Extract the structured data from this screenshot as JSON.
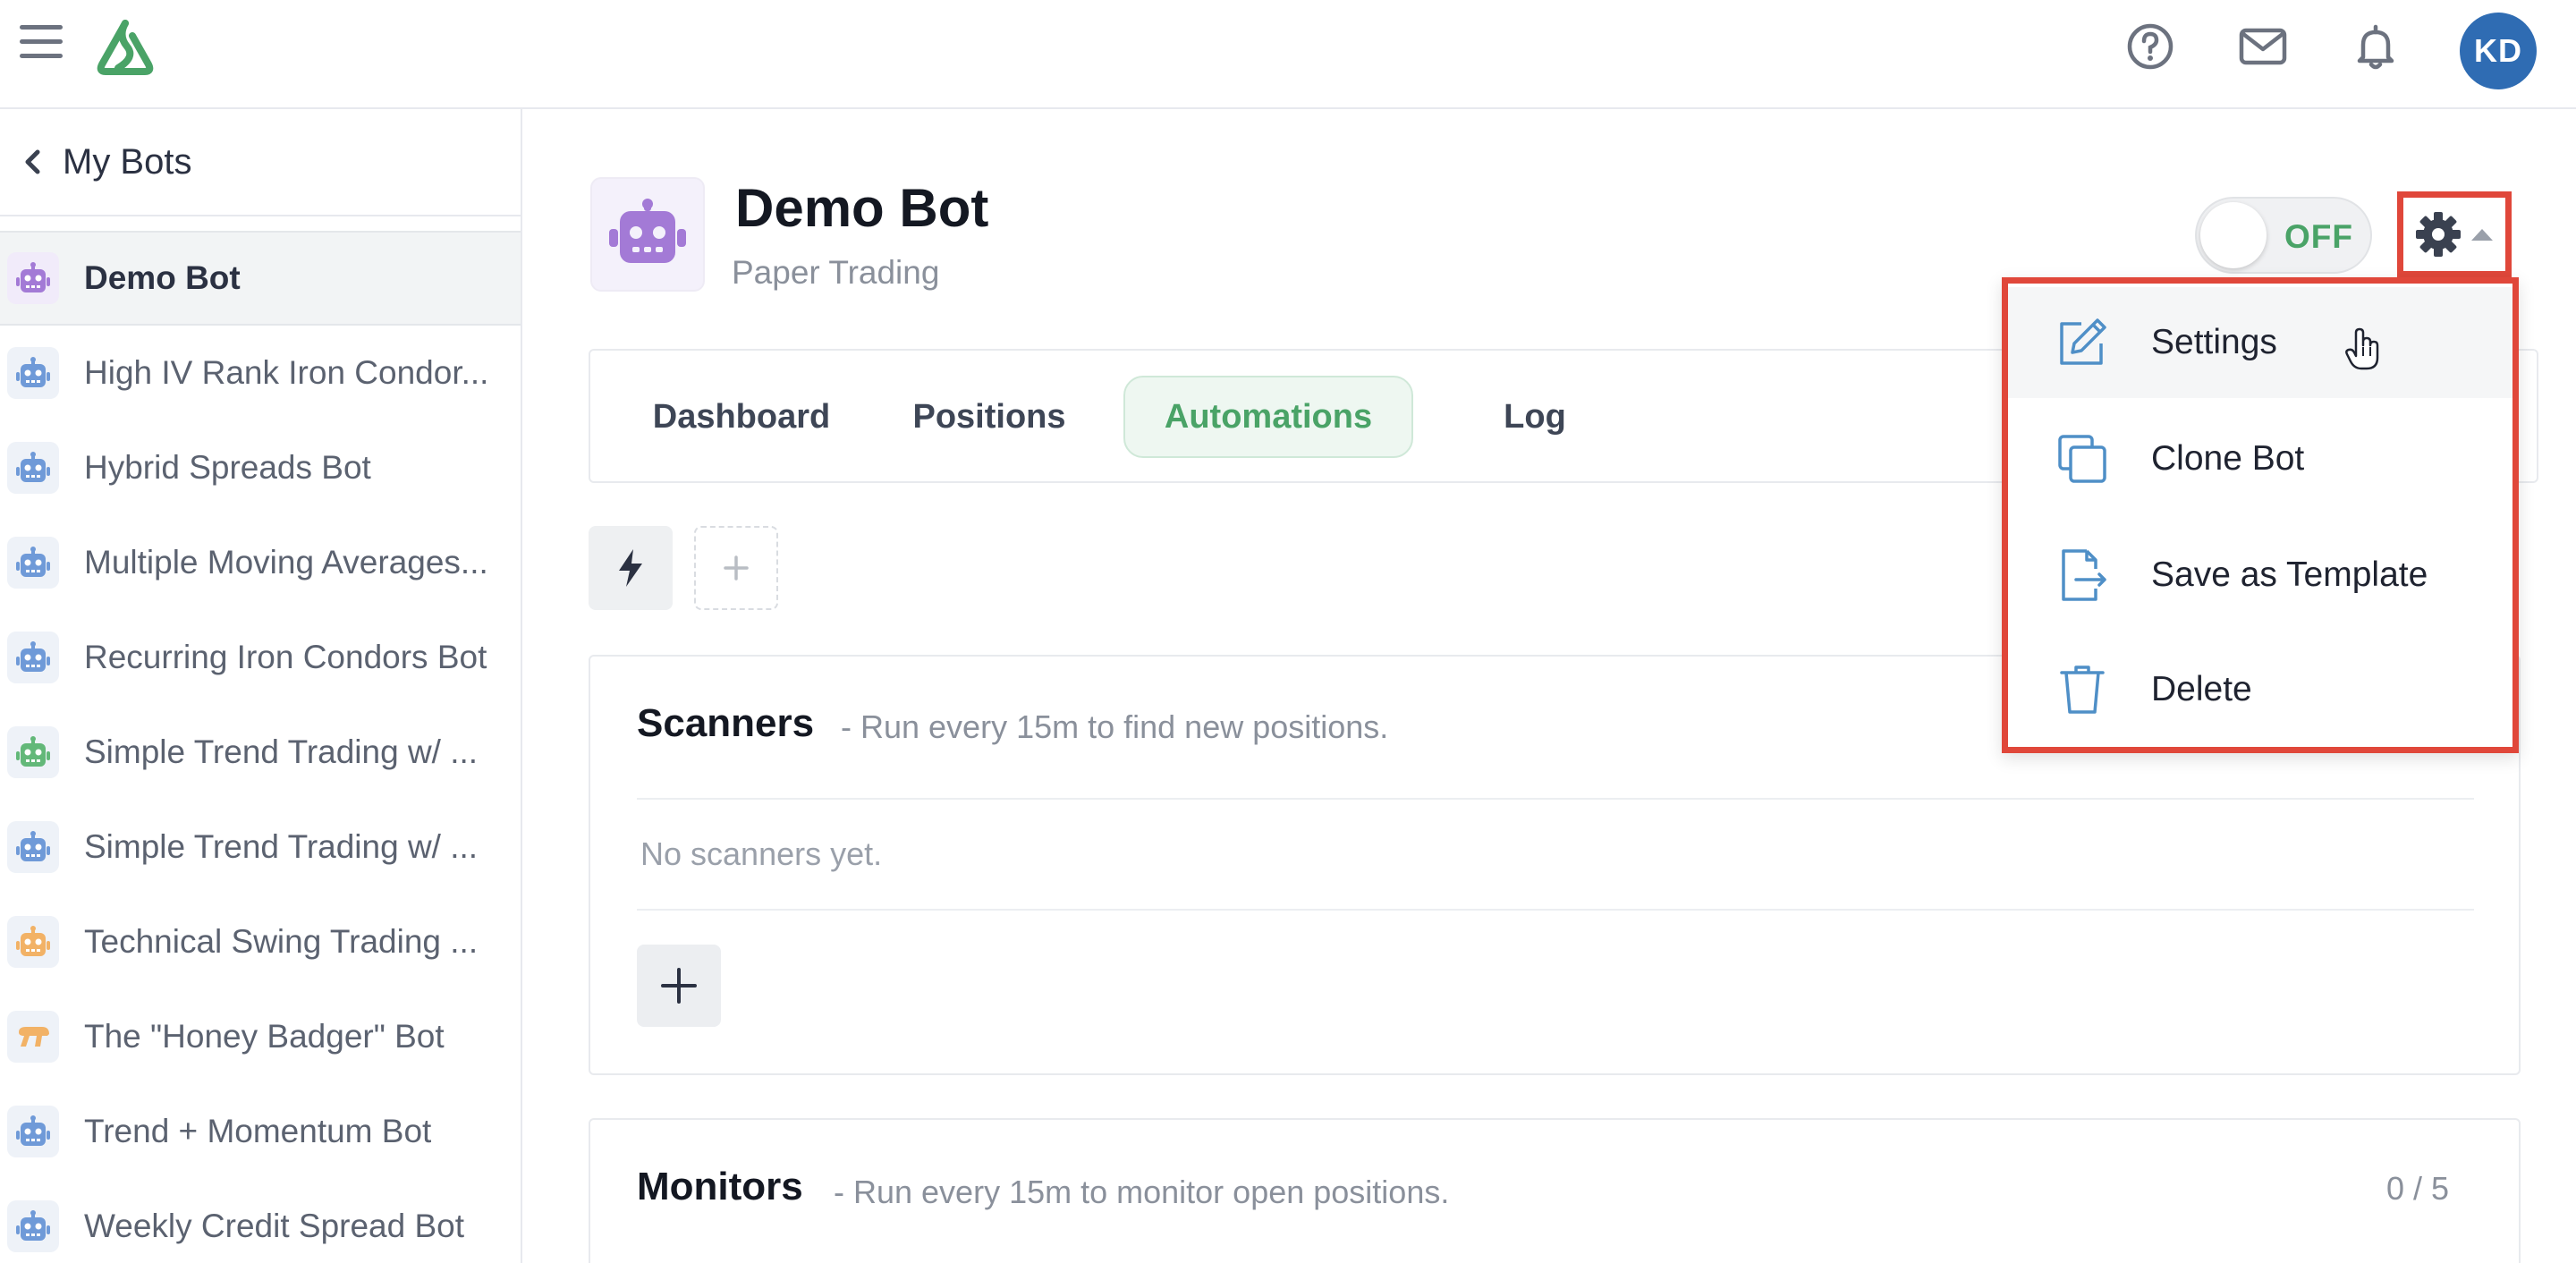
{
  "topbar": {
    "menu_icon": "hamburger-menu-icon",
    "logo_icon": "brand-logo-icon",
    "help_icon": "help-circle-icon",
    "mail_icon": "mail-icon",
    "bell_icon": "bell-icon",
    "avatar_initials": "KD",
    "brand_color": "#4aa367",
    "avatar_color": "#2f6cb3"
  },
  "sidebar": {
    "back_label": "My Bots",
    "items": [
      {
        "label": "Demo Bot",
        "color": "#a37ad6",
        "active": true
      },
      {
        "label": "High IV Rank Iron Condor...",
        "color": "#6f9ad8",
        "active": false
      },
      {
        "label": "Hybrid Spreads Bot",
        "color": "#6f9ad8",
        "active": false
      },
      {
        "label": "Multiple Moving Averages...",
        "color": "#6f9ad8",
        "active": false
      },
      {
        "label": "Recurring Iron Condors Bot",
        "color": "#6f9ad8",
        "active": false
      },
      {
        "label": "Simple Trend Trading w/ ...",
        "color": "#63b879",
        "active": false
      },
      {
        "label": "Simple Trend Trading w/ ...",
        "color": "#6f9ad8",
        "active": false
      },
      {
        "label": "Technical Swing Trading ...",
        "color": "#f2b266",
        "active": false
      },
      {
        "label": "The \"Honey Badger\" Bot",
        "color": "#f2b266",
        "active": false
      },
      {
        "label": "Trend + Momentum Bot",
        "color": "#6f9ad8",
        "active": false
      },
      {
        "label": "Weekly Credit Spread Bot",
        "color": "#6f9ad8",
        "active": false
      }
    ]
  },
  "header": {
    "title": "Demo Bot",
    "subtitle": "Paper Trading",
    "toggle_label": "OFF",
    "gear_icon": "gear-icon",
    "caret_icon": "caret-up-icon"
  },
  "tabs": [
    {
      "label": "Dashboard",
      "active": false
    },
    {
      "label": "Positions",
      "active": false
    },
    {
      "label": "Automations",
      "active": true
    },
    {
      "label": "Log",
      "active": false
    }
  ],
  "tools": {
    "lightning_icon": "lightning-icon",
    "add_icon": "plus-icon"
  },
  "scanners": {
    "title": "Scanners",
    "description": "- Run every 15m to find new positions.",
    "empty_text": "No scanners yet."
  },
  "monitors": {
    "title": "Monitors",
    "description": "- Run every 15m to monitor open positions.",
    "count": "0 / 5"
  },
  "dropdown": {
    "items": [
      {
        "label": "Settings",
        "icon": "edit-icon"
      },
      {
        "label": "Clone Bot",
        "icon": "clone-icon"
      },
      {
        "label": "Save as Template",
        "icon": "save-template-icon"
      },
      {
        "label": "Delete",
        "icon": "trash-icon"
      }
    ],
    "highlight_color": "#e0473a"
  }
}
